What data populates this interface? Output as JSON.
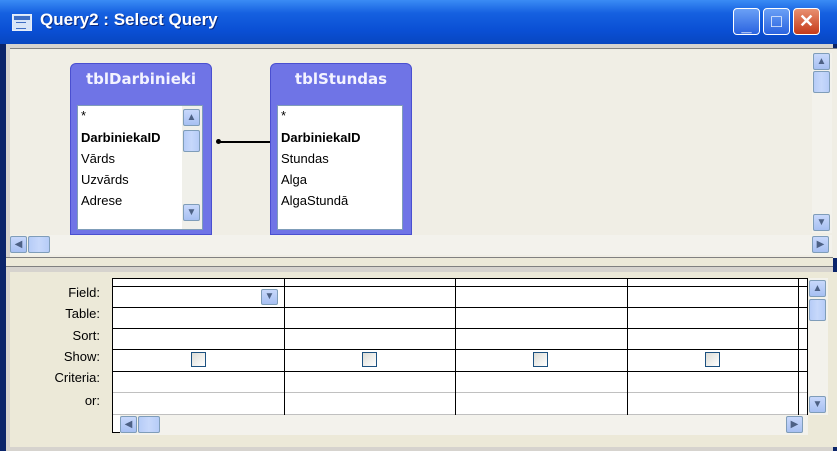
{
  "window": {
    "title": "Query2 : Select Query"
  },
  "title_buttons": {
    "minimize": "_",
    "maximize": "□",
    "close": "✕"
  },
  "tables": [
    {
      "name": "tblDarbinieki",
      "fields": [
        "*",
        "DarbiniekaID",
        "Vārds",
        "Uzvārds",
        "Adrese"
      ]
    },
    {
      "name": "tblStundas",
      "fields": [
        "*",
        "DarbiniekaID",
        "Stundas",
        "Alga",
        "AlgaStundā"
      ]
    }
  ],
  "design_grid": {
    "row_labels": [
      "Field:",
      "Table:",
      "Sort:",
      "Show:",
      "Criteria:",
      "or:"
    ],
    "columns": 4
  },
  "icons": {
    "scroll_up": "▲",
    "scroll_down": "▼",
    "scroll_left": "◀",
    "scroll_right": "▶"
  },
  "colors": {
    "titlebar": "#0a4fd4",
    "table_header": "#6f74e6",
    "workspace": "#f0eee5"
  }
}
